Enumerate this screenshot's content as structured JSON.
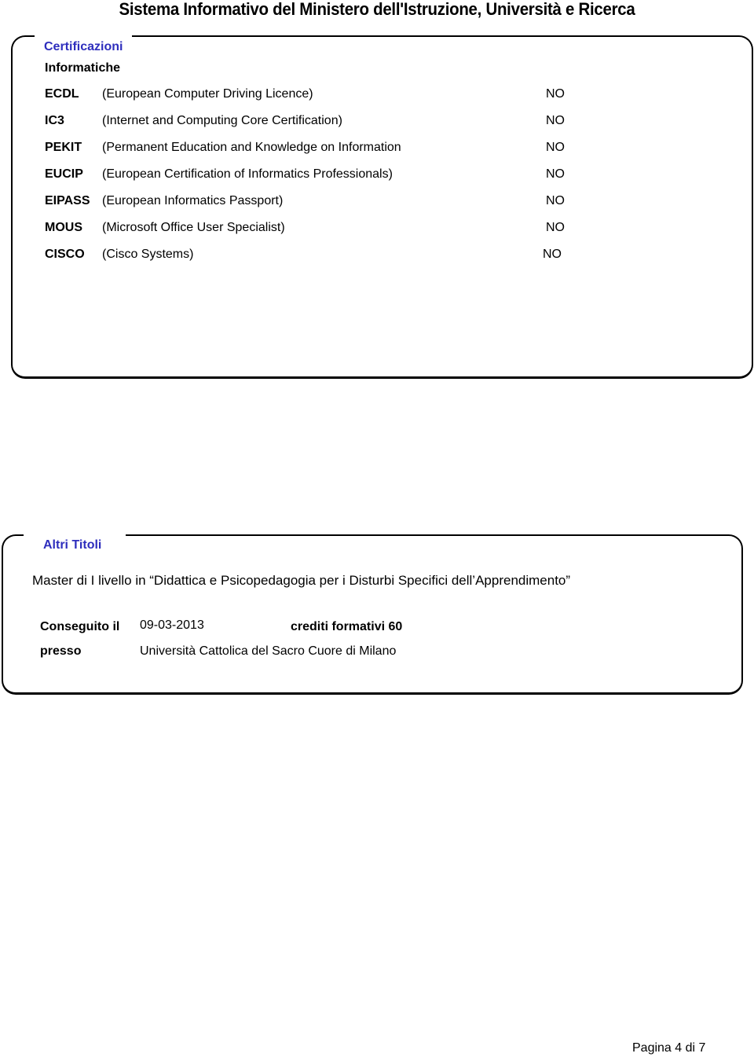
{
  "header": {
    "title": "Sistema Informativo del Ministero dell'Istruzione, Università e Ricerca"
  },
  "certificazioni": {
    "title": "Certificazioni",
    "subtitle": "Informatiche",
    "rows": [
      {
        "code": "ECDL",
        "description": "(European Computer Driving Licence)",
        "value": "NO"
      },
      {
        "code": "IC3",
        "description": "(Internet and Computing Core Certification)",
        "value": "NO"
      },
      {
        "code": "PEKIT",
        "description": "(Permanent Education and Knowledge on Information",
        "value": "NO"
      },
      {
        "code": "EUCIP",
        "description": "(European Certification of Informatics Professionals)",
        "value": "NO"
      },
      {
        "code": "EIPASS",
        "description": "(European Informatics Passport)",
        "value": "NO"
      },
      {
        "code": "MOUS",
        "description": "(Microsoft Office User Specialist)",
        "value": "NO"
      },
      {
        "code": "CISCO",
        "description": "(Cisco Systems)",
        "value": "NO"
      }
    ]
  },
  "altri_titoli": {
    "title": "Altri Titoli",
    "master": "Master di I livello in “Didattica e Psicopedagogia per i Disturbi Specifici dell’Apprendimento”",
    "conseguito_label": "Conseguito il",
    "conseguito_value": "09-03-2013",
    "crediti_label": "crediti formativi 60",
    "presso_label": "presso",
    "presso_value": "Università Cattolica del Sacro Cuore di Milano"
  },
  "footer": {
    "page_label": "Pagina 4 di 7"
  },
  "colors": {
    "section_title": "#2e2ebd",
    "text": "#000000",
    "background": "#ffffff"
  }
}
